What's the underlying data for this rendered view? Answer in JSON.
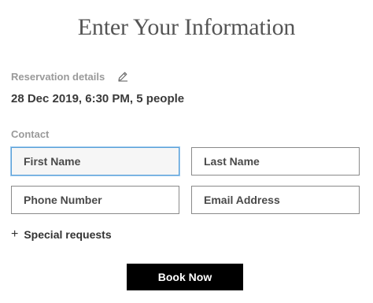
{
  "header": {
    "title": "Enter Your Information"
  },
  "reservation": {
    "label": "Reservation details",
    "edit_icon": "pencil-icon",
    "value": "28 Dec 2019, 6:30 PM, 5 people"
  },
  "contact": {
    "label": "Contact",
    "first_name": {
      "placeholder": "First Name",
      "value": ""
    },
    "last_name": {
      "placeholder": "Last Name",
      "value": ""
    },
    "phone": {
      "placeholder": "Phone Number",
      "value": ""
    },
    "email": {
      "placeholder": "Email Address",
      "value": ""
    }
  },
  "special_requests": {
    "icon": "+",
    "label": "Special requests"
  },
  "actions": {
    "book_label": "Book Now"
  },
  "colors": {
    "title": "#555555",
    "label": "#9a9a9a",
    "focus_border": "#5aa0d8",
    "button_bg": "#000000",
    "button_text": "#ffffff"
  }
}
